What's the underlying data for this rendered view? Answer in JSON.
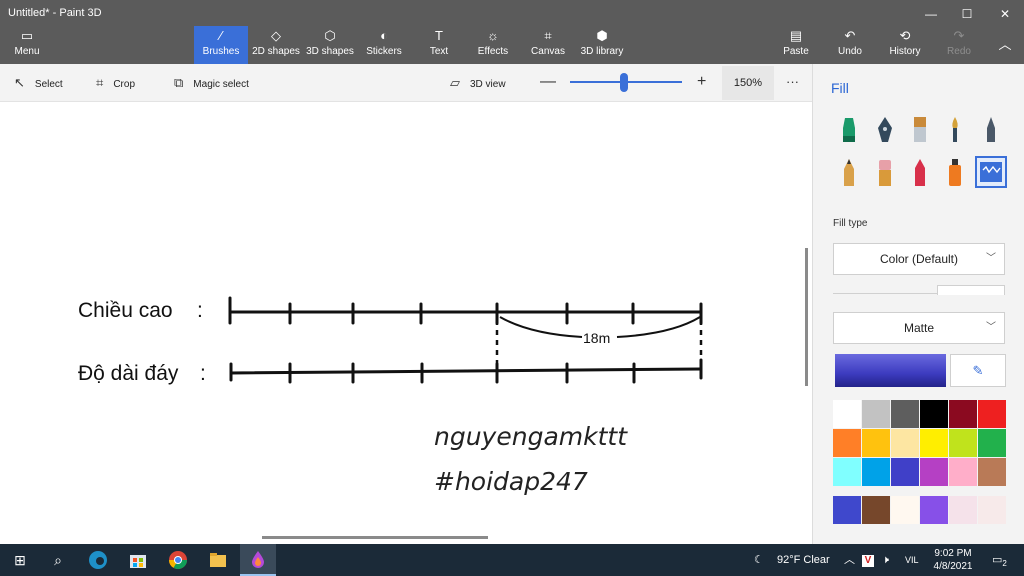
{
  "window": {
    "title": "Untitled* - Paint 3D",
    "minimize": "—",
    "maximize": "☐",
    "close": "✕"
  },
  "ribbon": {
    "menu": "Menu",
    "brushes": "Brushes",
    "shapes2d": "2D shapes",
    "shapes3d": "3D shapes",
    "stickers": "Stickers",
    "text": "Text",
    "effects": "Effects",
    "canvas": "Canvas",
    "library3d": "3D library",
    "paste": "Paste",
    "undo": "Undo",
    "history": "History",
    "redo": "Redo"
  },
  "toolbar": {
    "select": "Select",
    "crop": "Crop",
    "magic_select": "Magic select",
    "view3d": "3D view",
    "zoom_out": "—",
    "zoom_in": "+",
    "zoom_value": "150%",
    "more": "···",
    "zoom_level": 0.48
  },
  "canvas": {
    "label_height": "Chiều cao",
    "label_height_colon": ":",
    "label_base": "Độ dài đáy",
    "label_base_colon": ":",
    "measure": "18m",
    "signature": "nguyengamkttt",
    "hashtag": "#hoidap247"
  },
  "panel": {
    "title": "Fill",
    "brushes": [
      {
        "name": "marker-brush-icon",
        "color": "#1a9a6a"
      },
      {
        "name": "calligraphy-pen-icon",
        "color": "#33495c"
      },
      {
        "name": "oil-brush-icon",
        "color": "#c98a3a"
      },
      {
        "name": "watercolor-brush-icon",
        "color": "#d4a23a"
      },
      {
        "name": "pixel-pen-icon",
        "color": "#4a5868"
      },
      {
        "name": "pencil-icon",
        "color": "#d9a14a"
      },
      {
        "name": "eraser-icon",
        "color": "#e7a0a8"
      },
      {
        "name": "crayon-icon",
        "color": "#d8304a"
      },
      {
        "name": "spray-can-icon",
        "color": "#ee7a20"
      },
      {
        "name": "fill-bucket-icon",
        "color": "#3a6fd8"
      }
    ],
    "fill_type_label": "Fill type",
    "fill_type_value": "Color (Default)",
    "finish_value": "Matte",
    "current_color": "#3c3bbf",
    "palette": [
      "#ffffff",
      "#c2c2c2",
      "#5e5e5e",
      "#000000",
      "#8b0a20",
      "#ee2020",
      "#ff7f27",
      "#ffc20e",
      "#fde6a2",
      "#ffee00",
      "#c0e31c",
      "#22b14c",
      "#80ffff",
      "#00a2e8",
      "#4040c8",
      "#b540c4",
      "#ffaec9",
      "#b97a57"
    ],
    "custom_colors": [
      "#3f48cc",
      "#76472b",
      "#fff8f0",
      "#8750e8",
      "#f5e2ea",
      "#f7eaea"
    ]
  },
  "taskbar": {
    "weather": "92°F  Clear",
    "lang": "VIL",
    "time": "9:02 PM",
    "date": "4/8/2021",
    "notifications": "2"
  }
}
